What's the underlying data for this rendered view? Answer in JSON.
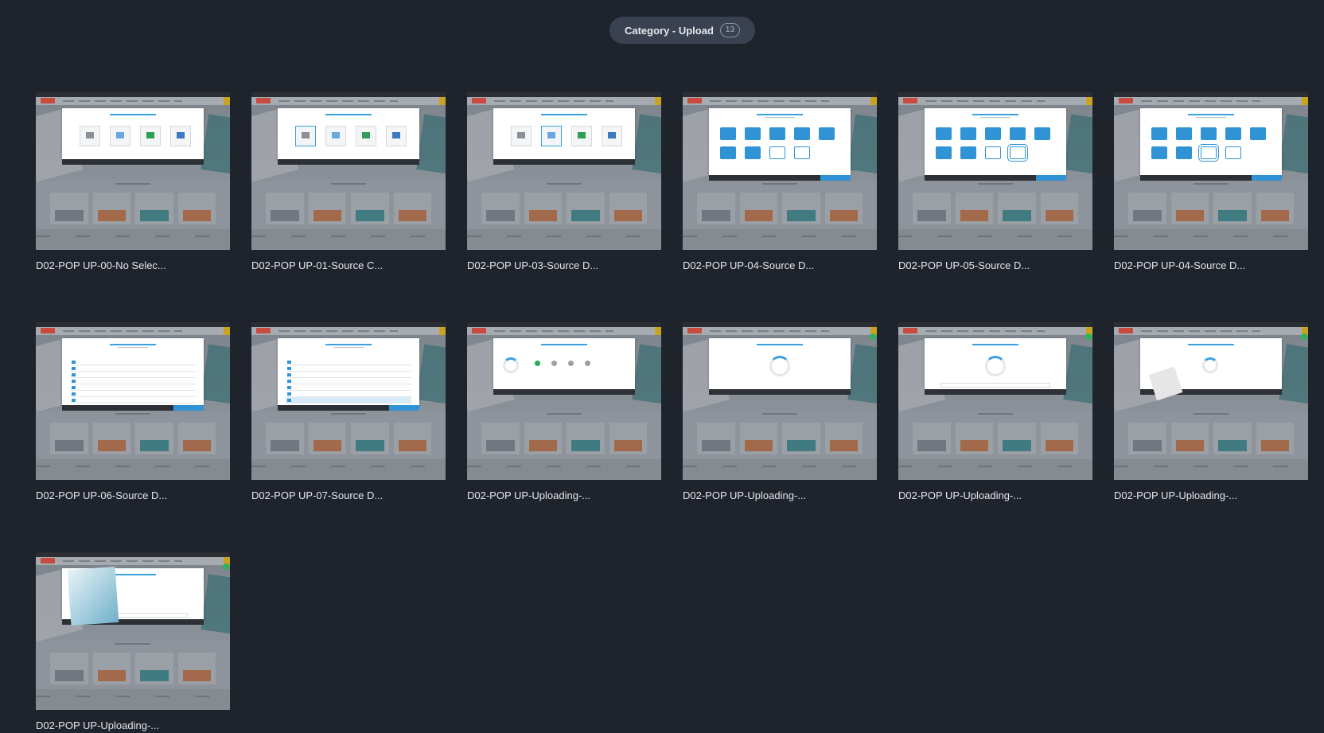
{
  "header": {
    "title": "Category - Upload",
    "count": "13"
  },
  "cards": [
    {
      "label": "D02-POP UP-00-No Selec...",
      "variant": "source",
      "selected": -1
    },
    {
      "label": "D02-POP UP-01-Source C...",
      "variant": "source",
      "selected": 0
    },
    {
      "label": "D02-POP UP-03-Source D...",
      "variant": "source",
      "selected": 1
    },
    {
      "label": "D02-POP UP-04-Source D...",
      "variant": "folders",
      "selected": -1
    },
    {
      "label": "D02-POP UP-05-Source D...",
      "variant": "folders",
      "selected": 8
    },
    {
      "label": "D02-POP UP-04-Source D...",
      "variant": "folders",
      "selected": 7
    },
    {
      "label": "D02-POP UP-06-Source D...",
      "variant": "list",
      "selected": -1
    },
    {
      "label": "D02-POP UP-07-Source D...",
      "variant": "list",
      "selected": 6
    },
    {
      "label": "D02-POP UP-Uploading-...",
      "variant": "upload-steps",
      "selected": -1
    },
    {
      "label": "D02-POP UP-Uploading-...",
      "variant": "upload-spinner",
      "selected": -1
    },
    {
      "label": "D02-POP UP-Uploading-...",
      "variant": "upload-spinner-msg",
      "selected": -1
    },
    {
      "label": "D02-POP UP-Uploading-...",
      "variant": "upload-paper",
      "selected": -1
    },
    {
      "label": "D02-POP UP-Uploading-...",
      "variant": "upload-booklet",
      "selected": -1
    }
  ]
}
